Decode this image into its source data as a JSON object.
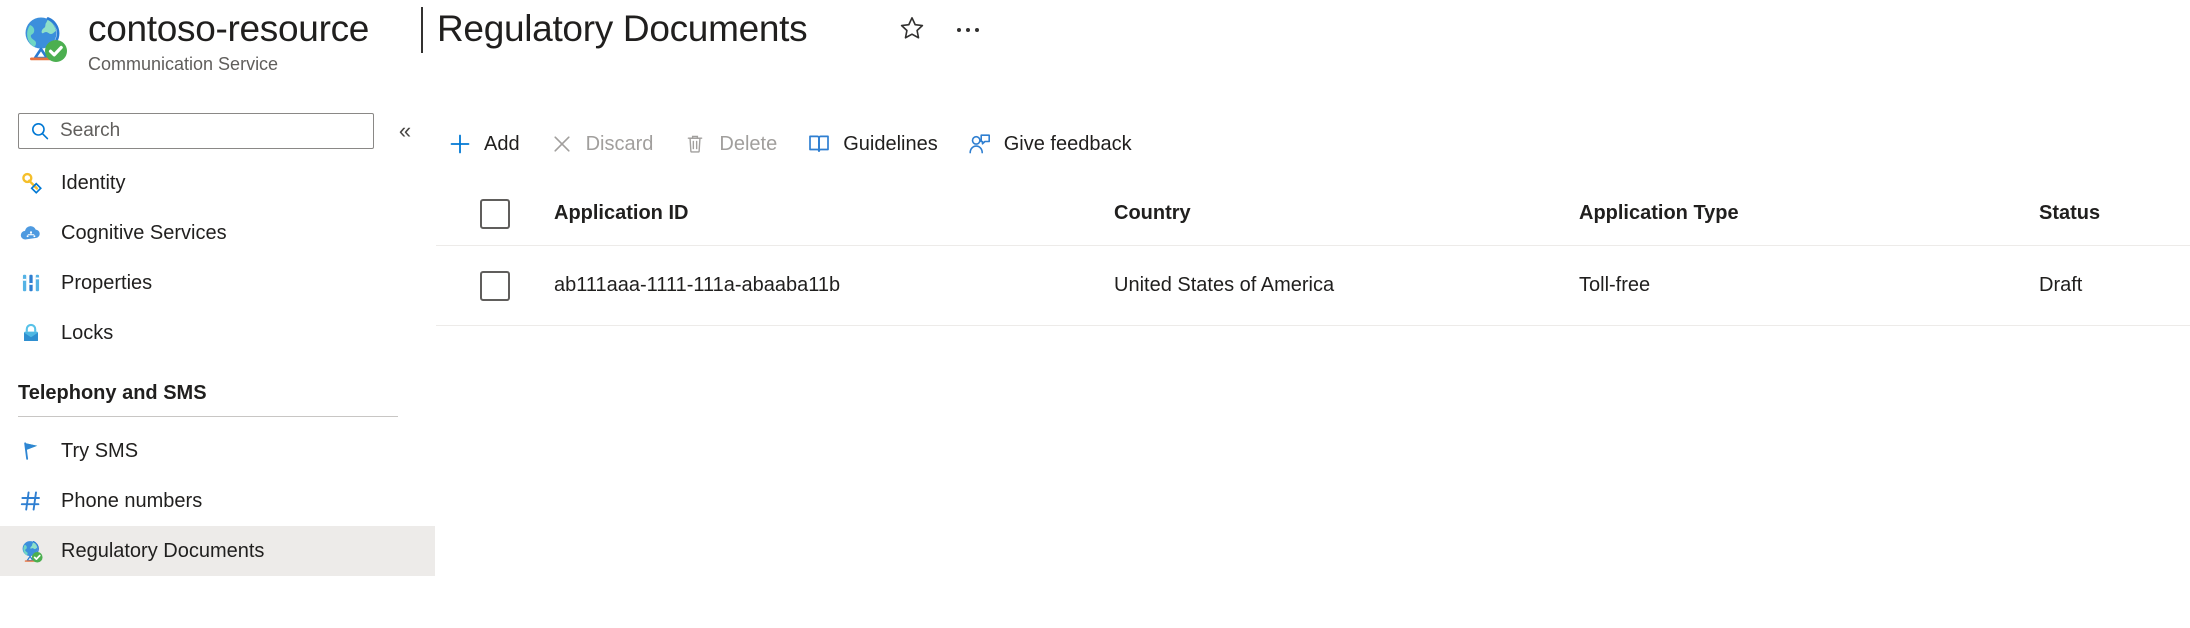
{
  "header": {
    "resource_icon": "globe-check-icon",
    "resource_name": "contoso-resource",
    "resource_type": "Communication Service",
    "title_separator": "|",
    "page_title": "Regulatory Documents",
    "favorite_icon": "star-outline-icon",
    "more_icon": "ellipsis-icon"
  },
  "sidebar": {
    "search": {
      "placeholder": "Search",
      "value": "",
      "icon": "search-icon"
    },
    "collapse_icon": "double-chevron-left-icon",
    "collapse_glyph": "«",
    "items": [
      {
        "label": "Identity",
        "icon": "key-icon",
        "selected": false
      },
      {
        "label": "Cognitive Services",
        "icon": "cloud-ai-icon",
        "selected": false
      },
      {
        "label": "Properties",
        "icon": "sliders-icon",
        "selected": false
      },
      {
        "label": "Locks",
        "icon": "lock-icon",
        "selected": false
      }
    ],
    "group": {
      "title": "Telephony and SMS",
      "items": [
        {
          "label": "Try SMS",
          "icon": "flag-icon",
          "selected": false
        },
        {
          "label": "Phone numbers",
          "icon": "hash-icon",
          "selected": false
        },
        {
          "label": "Regulatory Documents",
          "icon": "globe-check-icon",
          "selected": true
        }
      ]
    }
  },
  "toolbar": {
    "buttons": [
      {
        "label": "Add",
        "icon": "plus-icon",
        "disabled": false
      },
      {
        "label": "Discard",
        "icon": "close-x-icon",
        "disabled": true
      },
      {
        "label": "Delete",
        "icon": "trash-icon",
        "disabled": true
      },
      {
        "label": "Guidelines",
        "icon": "book-icon",
        "disabled": false
      },
      {
        "label": "Give feedback",
        "icon": "person-feedback-icon",
        "disabled": false
      }
    ]
  },
  "table": {
    "select_all_checked": false,
    "columns": [
      "Application ID",
      "Country",
      "Application Type",
      "Status"
    ],
    "rows": [
      {
        "checked": false,
        "application_id": "ab111aaa-1111-111a-abaaba11b",
        "country": "United States of America",
        "application_type": "Toll-free",
        "status": "Draft"
      }
    ]
  },
  "colors": {
    "accent_blue": "#0078d4",
    "text_primary": "#201f1e",
    "text_secondary": "#605e5c",
    "text_disabled": "#a19f9d",
    "selected_row_bg": "#edebe9",
    "divider": "#edebe9"
  }
}
